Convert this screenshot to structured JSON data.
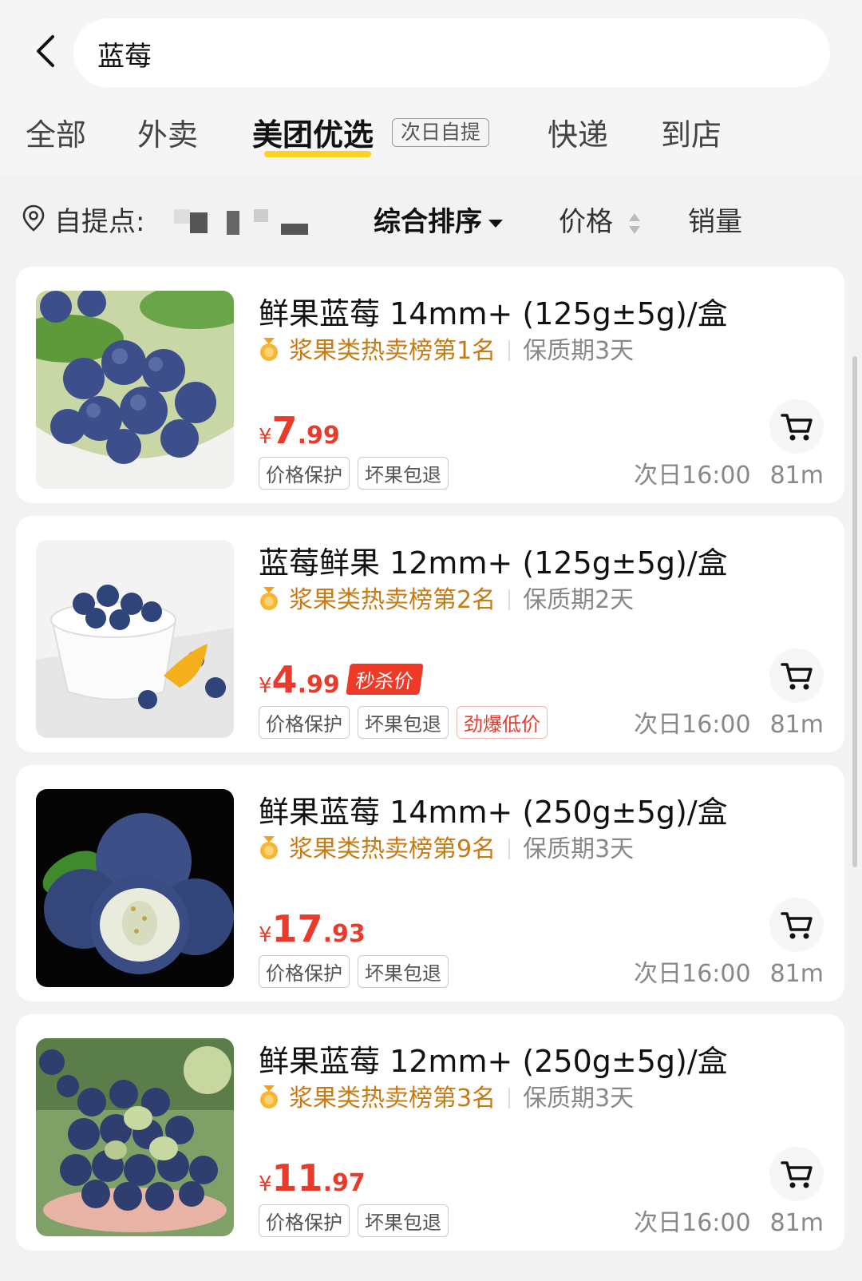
{
  "search": {
    "query": "蓝莓"
  },
  "tabs": [
    {
      "label": "全部"
    },
    {
      "label": "外卖"
    },
    {
      "label": "美团优选",
      "badge": "次日自提"
    },
    {
      "label": "快递"
    },
    {
      "label": "到店"
    }
  ],
  "filter": {
    "pickup_label": "自提点:",
    "sort_default": "综合排序",
    "sort_price": "价格",
    "sort_sales": "销量"
  },
  "colors": {
    "accent": "#ffcf21",
    "price": "#e93b2b",
    "rank": "#c97a12"
  },
  "products": [
    {
      "title": "鲜果蓝莓 14mm+ (125g±5g)/盒",
      "rank": "浆果类热卖榜第1名",
      "shelf": "保质期3天",
      "currency": "¥",
      "price_int": "7",
      "price_dec": ".99",
      "tags": [
        "价格保护",
        "坏果包退"
      ],
      "delivery": "次日16:00",
      "distance": "81m"
    },
    {
      "title": "蓝莓鲜果 12mm+ (125g±5g)/盒",
      "rank": "浆果类热卖榜第2名",
      "shelf": "保质期2天",
      "currency": "¥",
      "price_int": "4",
      "price_dec": ".99",
      "flash": "秒杀价",
      "tags": [
        "价格保护",
        "坏果包退"
      ],
      "extra_tag": "劲爆低价",
      "delivery": "次日16:00",
      "distance": "81m"
    },
    {
      "title": "鲜果蓝莓 14mm+ (250g±5g)/盒",
      "rank": "浆果类热卖榜第9名",
      "shelf": "保质期3天",
      "currency": "¥",
      "price_int": "17",
      "price_dec": ".93",
      "tags": [
        "价格保护",
        "坏果包退"
      ],
      "delivery": "次日16:00",
      "distance": "81m"
    },
    {
      "title": "鲜果蓝莓 12mm+ (250g±5g)/盒",
      "rank": "浆果类热卖榜第3名",
      "shelf": "保质期3天",
      "currency": "¥",
      "price_int": "11",
      "price_dec": ".97",
      "tags": [
        "价格保护",
        "坏果包退"
      ],
      "delivery": "次日16:00",
      "distance": "81m"
    }
  ]
}
